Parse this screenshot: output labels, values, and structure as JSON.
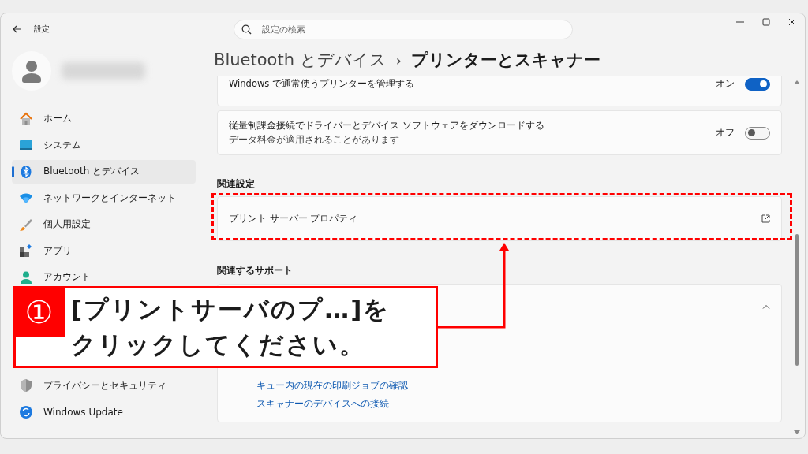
{
  "window": {
    "title": "設定"
  },
  "search": {
    "placeholder": "設定の検索"
  },
  "sidebar": {
    "items": [
      {
        "label": "ホーム",
        "selected": false
      },
      {
        "label": "システム",
        "selected": false
      },
      {
        "label": "Bluetooth とデバイス",
        "selected": true
      },
      {
        "label": "ネットワークとインターネット",
        "selected": false
      },
      {
        "label": "個人用設定",
        "selected": false
      },
      {
        "label": "アプリ",
        "selected": false
      },
      {
        "label": "アカウント",
        "selected": false
      },
      {
        "label": "プライバシーとセキュリティ",
        "selected": false
      },
      {
        "label": "Windows Update",
        "selected": false
      }
    ]
  },
  "breadcrumb": {
    "parent": "Bluetooth とデバイス",
    "separator": "›",
    "current": "プリンターとスキャナー"
  },
  "settings": [
    {
      "title": "Windows で通常使うプリンターを管理する",
      "toggle_label": "オン",
      "on": true
    },
    {
      "title": "従量制課金接続でドライバーとデバイス ソフトウェアをダウンロードする",
      "subtitle": "データ料金が適用されることがあります",
      "toggle_label": "オフ",
      "on": false
    }
  ],
  "related_settings": {
    "heading": "関連設定",
    "items": [
      {
        "label": "プリント サーバー プロパティ",
        "highlighted": true
      }
    ]
  },
  "related_support": {
    "heading": "関連するサポート",
    "expander": {
      "expanded": true,
      "links": [
        "キュー内の現在の印刷ジョブの確認",
        "スキャナーのデバイスへの接続"
      ]
    }
  },
  "callout": {
    "number": "①",
    "lines": [
      "[プリントサーバのプ…]を",
      "クリックしてください。"
    ]
  }
}
